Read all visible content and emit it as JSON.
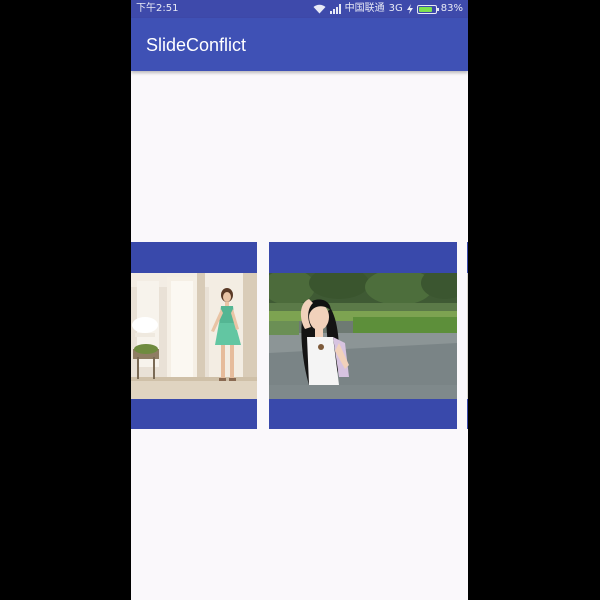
{
  "status_bar": {
    "time": "下午2:51",
    "carrier": "中国联通",
    "network": "3G",
    "battery": "83%",
    "battery_level": 0.83
  },
  "app_bar": {
    "title": "SlideConflict",
    "color": "#3f51b5"
  },
  "pager": {
    "pages": [
      {
        "photo": "girl-green-dress-photo"
      },
      {
        "photo": "girl-white-top-park-photo"
      },
      {
        "photo": "partial-next-page"
      }
    ]
  }
}
